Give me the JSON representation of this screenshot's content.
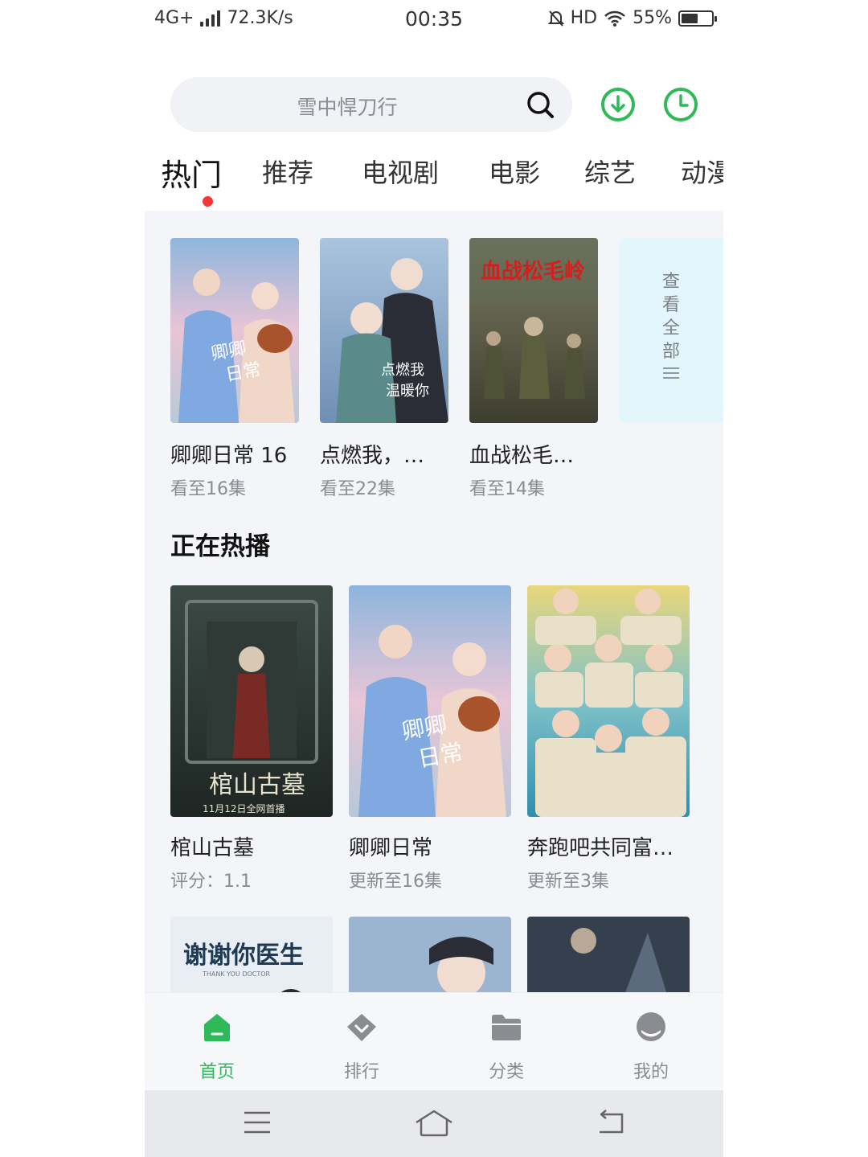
{
  "status_bar": {
    "network": "4G+",
    "speed": "72.3K/s",
    "time": "00:35",
    "hd": "HD",
    "battery": "55%",
    "battery_level": 0.55
  },
  "search": {
    "placeholder": "雪中悍刀行"
  },
  "tabs": [
    "热门",
    "推荐",
    "电视剧",
    "电影",
    "综艺",
    "动漫"
  ],
  "active_tab": 0,
  "history": [
    {
      "title": "卿卿日常 16",
      "progress": "看至16集"
    },
    {
      "title": "点燃我，…",
      "progress": "看至22集"
    },
    {
      "title": "血战松毛…",
      "progress": "看至14集",
      "poster_text": "血战松毛岭"
    }
  ],
  "view_all": {
    "chars": [
      "查",
      "看",
      "全",
      "部"
    ]
  },
  "hot_section": {
    "title": "正在热播",
    "items": [
      {
        "title": "棺山古墓",
        "sub": "评分：1.1",
        "poster_text": "棺山古墓",
        "poster_date": "11月12日全网首播"
      },
      {
        "title": "卿卿日常",
        "sub": "更新至16集"
      },
      {
        "title": "奔跑吧共同富…",
        "sub": "更新至3集"
      }
    ],
    "next_row": [
      {
        "poster_text": "谢谢你医生",
        "poster_sub": "THANK YOU DOCTOR"
      },
      {},
      {}
    ]
  },
  "bottom_nav": [
    {
      "label": "首页",
      "icon": "home-icon",
      "active": true
    },
    {
      "label": "排行",
      "icon": "rank-diamond-icon",
      "active": false
    },
    {
      "label": "分类",
      "icon": "folder-icon",
      "active": false
    },
    {
      "label": "我的",
      "icon": "profile-icon",
      "active": false
    }
  ],
  "colors": {
    "accent_green": "#2fba5a",
    "active_dot": "#f0383a"
  }
}
